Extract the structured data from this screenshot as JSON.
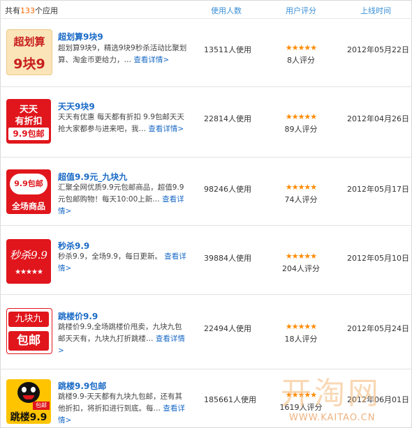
{
  "header": {
    "count_prefix": "共有",
    "count_number": "133",
    "count_suffix": "个应用",
    "col_users": "使用人数",
    "col_rating": "用户评分",
    "col_date": "上线时间"
  },
  "apps": [
    {
      "title": "超划算9块9",
      "icon_lines": [
        "超划算",
        "9块9"
      ],
      "desc_prefix": "超划算9块9，精选9块9秒杀活动比聚划算、淘金币更给力，…",
      "more": "查看详情>",
      "users": "13511人使用",
      "stars": "★★★★★",
      "rating_count": "8人评分",
      "date": "2012年05月22日"
    },
    {
      "title": "天天9块9",
      "icon_lines": [
        "天天",
        "有折扣",
        "9.9包邮"
      ],
      "desc_prefix": "天天有优惠 每天都有折扣 9.9包邮天天抢大家都参与进来吧，我…",
      "more": "查看详情>",
      "users": "22814人使用",
      "stars": "★★★★★",
      "rating_count": "89人评分",
      "date": "2012年04月26日"
    },
    {
      "title": "超值9.9元_九块九",
      "icon_lines": [
        "9.9包邮",
        "全场商品"
      ],
      "desc_prefix": "汇聚全网优质9.9元包邮商品，超值9.9元包邮购物！每天10:00上新…",
      "more": "查看详情>",
      "users": "98246人使用",
      "stars": "★★★★★",
      "rating_count": "74人评分",
      "date": "2012年05月17日"
    },
    {
      "title": "秒杀9.9",
      "icon_lines": [
        "秒杀9.9",
        "★★★★★"
      ],
      "desc_prefix": "秒杀9.9，全场9.9，每日更新。",
      "more": "查看详情>",
      "users": "39884人使用",
      "stars": "★★★★★",
      "rating_count": "204人评分",
      "date": "2012年05月10日"
    },
    {
      "title": "跳楼价9.9",
      "icon_lines": [
        "九块九",
        "包邮"
      ],
      "desc_prefix": "跳楼价9.9,全场跳楼价甩卖，九块九包邮天天有，九块九打折跳楼…",
      "more": "查看详情>",
      "users": "22494人使用",
      "stars": "★★★★★",
      "rating_count": "18人评分",
      "date": "2012年05月24日"
    },
    {
      "title": "跳楼9.9包邮",
      "icon_lines": [
        "包邮",
        "跳楼9.9"
      ],
      "desc_prefix": "跳楼9.9-天天都有九块九包邮，还有其他折扣，将折扣进行到底。每…",
      "more": "查看详情>",
      "users": "185661人使用",
      "stars": "★★★★★",
      "rating_count": "1619人评分",
      "date": "2012年06月01日"
    }
  ],
  "watermark": {
    "logo_text": "开淘网",
    "url": "WWW.KAITAO.CN"
  }
}
